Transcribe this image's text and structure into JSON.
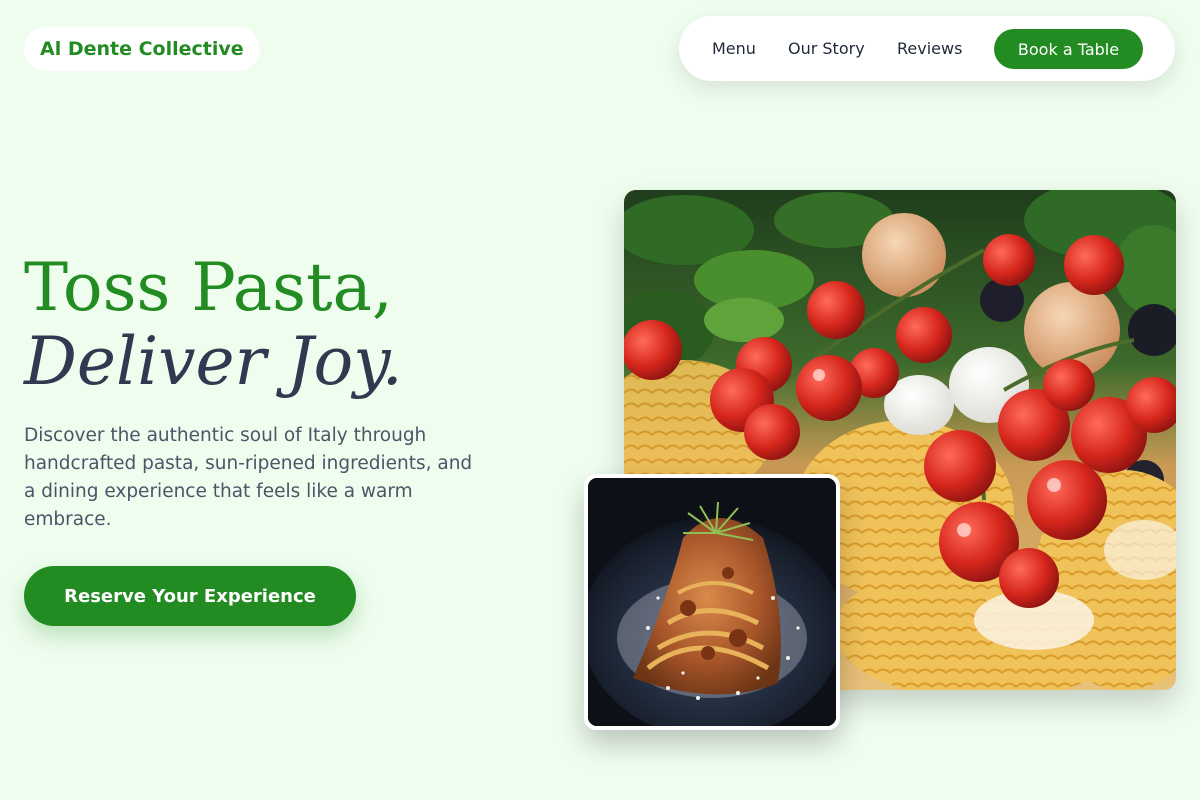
{
  "brand": {
    "name": "Al Dente Collective"
  },
  "nav": {
    "items": [
      {
        "label": "Menu"
      },
      {
        "label": "Our Story"
      },
      {
        "label": "Reviews"
      }
    ],
    "cta_label": "Book a Table"
  },
  "hero": {
    "title_line1": "Toss Pasta,",
    "title_line2": "Deliver Joy.",
    "description": "Discover the authentic soul of Italy through handcrafted pasta, sun-ripened ingredients, and a dining experience that feels like a warm embrace.",
    "cta_label": "Reserve Your Experience"
  },
  "images": {
    "main_alt": "Fresh pasta nests with cherry tomatoes, basil and eggs",
    "thumb_alt": "Plated tagliatelle with bolognese and parmesan"
  },
  "colors": {
    "background": "#effdef",
    "accent": "#228b22",
    "heading_dark": "#2d3a4f",
    "body_text": "#4a5568"
  }
}
